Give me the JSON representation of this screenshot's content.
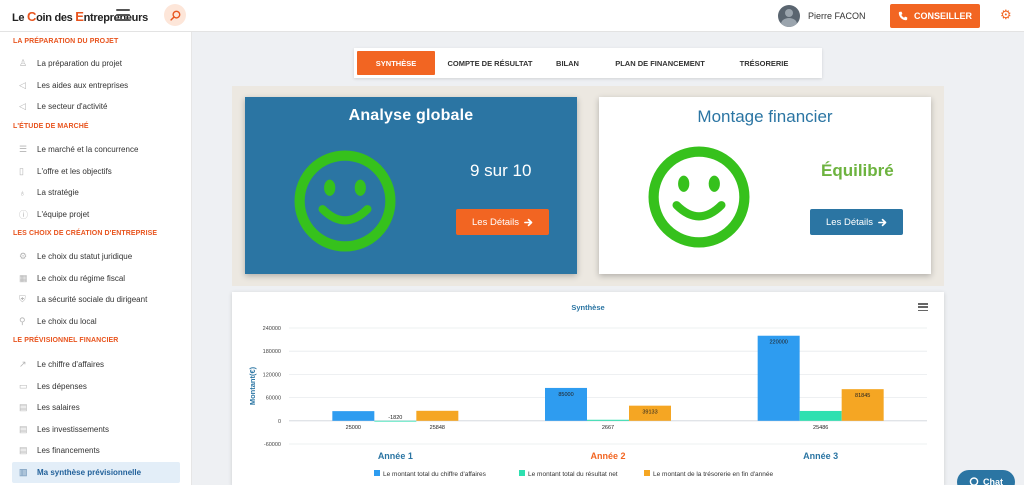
{
  "header": {
    "logo_prefix": "Le ",
    "logo_c": "C",
    "logo_mid": "oin des ",
    "logo_e": "E",
    "logo_suffix": "ntrepreneurs",
    "user_name": "Pierre FACON",
    "conseiller_label": "CONSEILLER"
  },
  "sidebar": {
    "sections": [
      {
        "title": "LA PRÉPARATION DU PROJET",
        "items": [
          {
            "label": "La préparation du projet",
            "icon": "person-icon"
          },
          {
            "label": "Les aides aux entreprises",
            "icon": "megaphone-icon"
          },
          {
            "label": "Le secteur d'activité",
            "icon": "megaphone-icon"
          }
        ]
      },
      {
        "title": "L'ÉTUDE DE MARCHÉ",
        "items": [
          {
            "label": "Le marché et la concurrence",
            "icon": "list-icon"
          },
          {
            "label": "L'offre et les objectifs",
            "icon": "document-icon"
          },
          {
            "label": "La stratégie",
            "icon": "lightbulb-icon"
          },
          {
            "label": "L'équipe projet",
            "icon": "info-icon"
          }
        ]
      },
      {
        "title": "LES CHOIX DE CRÉATION D'ENTREPRISE",
        "items": [
          {
            "label": "Le choix du statut juridique",
            "icon": "gear-icon"
          },
          {
            "label": "Le choix du régime fiscal",
            "icon": "calendar-icon"
          },
          {
            "label": "La sécurité sociale du dirigeant",
            "icon": "shield-icon"
          },
          {
            "label": "Le choix du local",
            "icon": "pin-icon"
          }
        ]
      },
      {
        "title": "LE PRÉVISIONNEL FINANCIER",
        "items": [
          {
            "label": "Le chiffre d'affaires",
            "icon": "trend-icon"
          },
          {
            "label": "Les dépenses",
            "icon": "wallet-icon"
          },
          {
            "label": "Les salaires",
            "icon": "table-icon"
          },
          {
            "label": "Les investissements",
            "icon": "table-icon"
          },
          {
            "label": "Les financements",
            "icon": "table-icon"
          },
          {
            "label": "Ma synthèse prévisionnelle",
            "icon": "bar-chart-icon",
            "active": true
          }
        ]
      }
    ]
  },
  "tabs": [
    {
      "label": "SYNTHÈSE",
      "active": true
    },
    {
      "label": "COMPTE DE RÉSULTAT"
    },
    {
      "label": "BILAN"
    },
    {
      "label": "PLAN DE FINANCEMENT"
    },
    {
      "label": "TRÉSORERIE"
    }
  ],
  "cards": {
    "global": {
      "title": "Analyse globale",
      "score": "9 sur 10",
      "button": "Les Détails"
    },
    "montage": {
      "title": "Montage financier",
      "status": "Équilibré",
      "button": "Les Détails"
    }
  },
  "colors": {
    "accent": "#f26522",
    "blue": "#2b75a3",
    "smiley_green": "#36c11c",
    "status_green": "#6db33f",
    "series_ca": "#2e9cf0",
    "series_resultat": "#2ee0b0",
    "series_tresorerie": "#f5a623"
  },
  "chat": {
    "label": "Chat"
  },
  "chart_data": {
    "type": "bar",
    "title": "Synthèse",
    "ylabel": "Montant(€)",
    "xlabel": "",
    "categories": [
      "Année 1",
      "Année 2",
      "Année 3"
    ],
    "ylim": [
      -60000,
      240000
    ],
    "yticks": [
      -60000,
      0,
      60000,
      120000,
      180000,
      240000
    ],
    "grid": true,
    "legend_position": "bottom",
    "series": [
      {
        "name": "Le montant total du chiffre d'affaires",
        "values": [
          25000,
          85000,
          220000
        ],
        "labels": [
          "25000",
          "85000",
          "220000"
        ]
      },
      {
        "name": "Le montant total du résultat net",
        "values": [
          -1820,
          2667,
          25486
        ],
        "labels": [
          "-1820",
          "2667",
          "25486"
        ]
      },
      {
        "name": "Le montant de la trésorerie en fin d'année",
        "values": [
          25848,
          39133,
          81845
        ],
        "labels": [
          "25848",
          "39133",
          "81845"
        ]
      }
    ]
  }
}
